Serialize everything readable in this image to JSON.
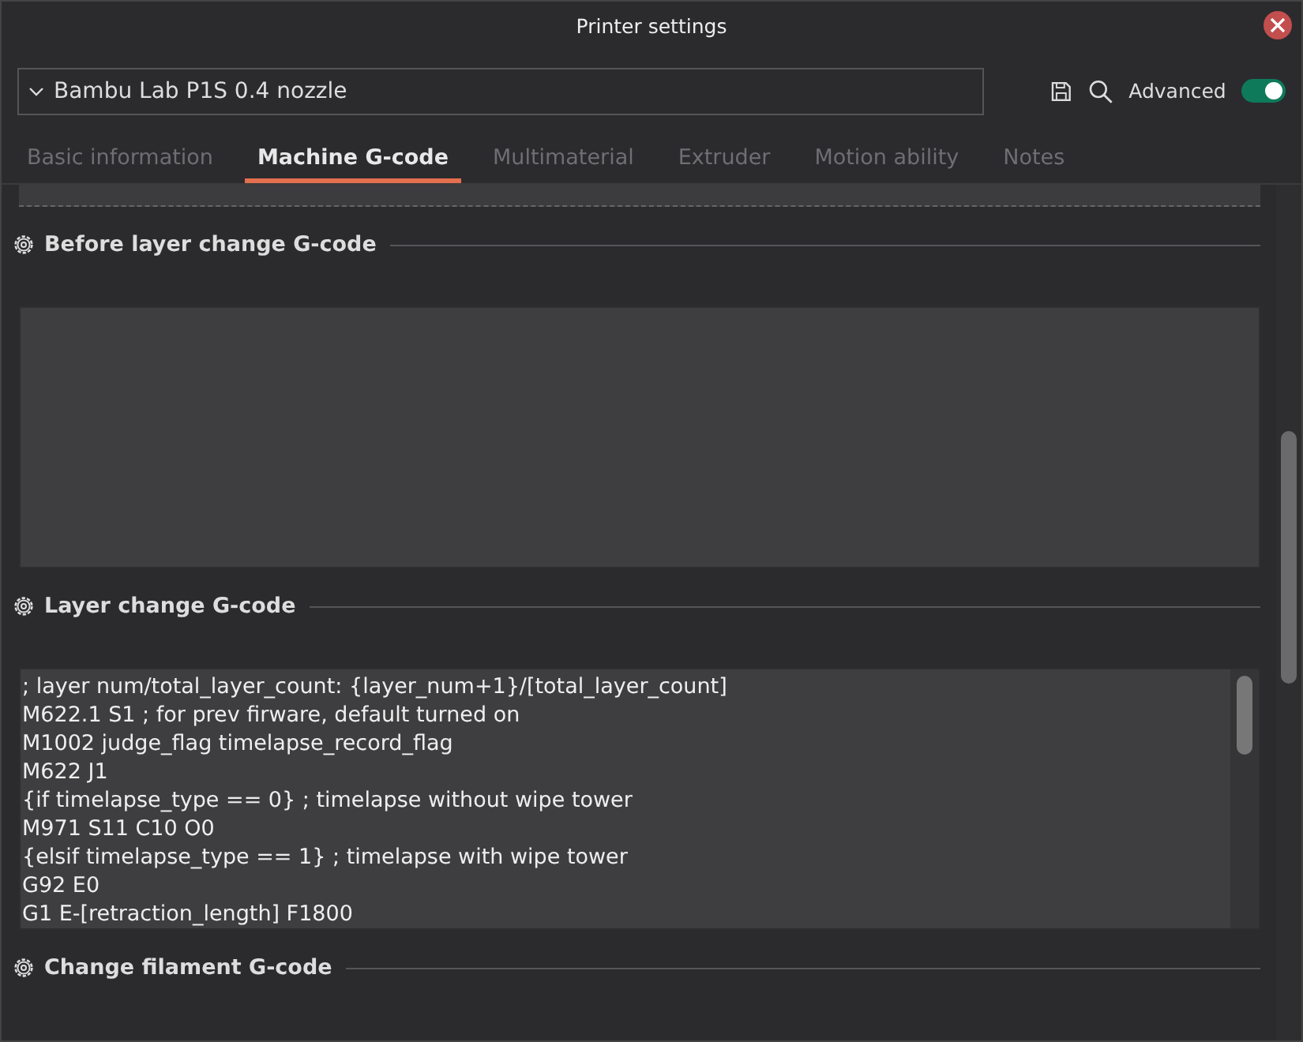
{
  "window": {
    "title": "Printer settings"
  },
  "preset": {
    "name": "Bambu Lab P1S 0.4 nozzle"
  },
  "toolbar": {
    "advanced_label": "Advanced",
    "advanced_on": true
  },
  "tabs": [
    {
      "label": "Basic information",
      "selected": false
    },
    {
      "label": "Machine G-code",
      "selected": true
    },
    {
      "label": "Multimaterial",
      "selected": false
    },
    {
      "label": "Extruder",
      "selected": false
    },
    {
      "label": "Motion ability",
      "selected": false
    },
    {
      "label": "Notes",
      "selected": false
    }
  ],
  "sections": [
    {
      "title": "Before layer change G-code"
    },
    {
      "title": "Layer change G-code",
      "lines": [
        "; layer num/total_layer_count: {layer_num+1}/[total_layer_count]",
        "M622.1 S1 ; for prev firware, default turned on",
        "M1002 judge_flag timelapse_record_flag",
        "M622 J1",
        "{if timelapse_type == 0} ; timelapse without wipe tower",
        "M971 S11 C10 O0",
        "{elsif timelapse_type == 1} ; timelapse with wipe tower",
        "G92 E0",
        "G1 E-[retraction_length] F1800"
      ]
    },
    {
      "title": "Change filament G-code"
    }
  ]
}
